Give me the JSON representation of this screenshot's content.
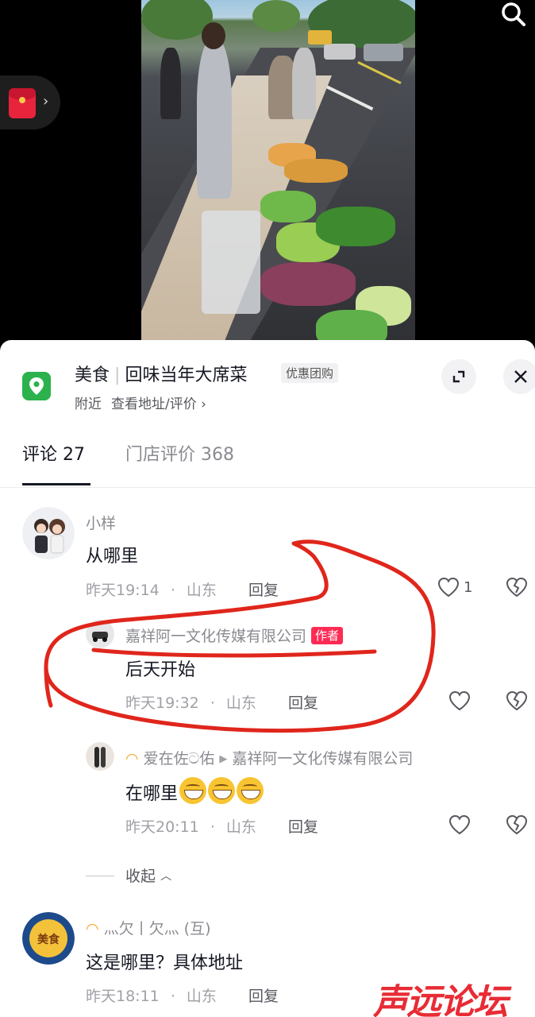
{
  "poi": {
    "category": "美食",
    "name": "回味当年大席菜",
    "badge": "优惠团购",
    "distance": "附近",
    "view_address": "查看地址/评价",
    "chevron": "›"
  },
  "tabs": [
    {
      "label": "评论 27",
      "active": true
    },
    {
      "label": "门店评价 368",
      "active": false
    }
  ],
  "comments": [
    {
      "user": "小样",
      "text": "从哪里",
      "time": "昨天19:14",
      "location": "山东",
      "reply_label": "回复",
      "likes": "1"
    },
    {
      "user": "嘉祥阿一文化传媒有限公司",
      "author_tag": "作者",
      "text": "后天开始",
      "time": "昨天19:32",
      "location": "山东",
      "reply_label": "回复"
    },
    {
      "user": "爱在佐ට佑",
      "reply_to": "嘉祥阿一文化传媒有限公司",
      "text": "在哪里",
      "time": "昨天20:11",
      "location": "山东",
      "reply_label": "回复"
    },
    {
      "user": "灬欠丨欠灬 (互)",
      "text": "这是哪里？具体地址",
      "time": "昨天18:11",
      "location": "山东",
      "reply_label": "回复"
    }
  ],
  "collapse_label": "收起",
  "dot": "·",
  "watermark": "声远论坛",
  "colors": {
    "accent": "#fe2c55",
    "poi_green": "#2bb24c",
    "annotation_red": "#e0261c"
  }
}
